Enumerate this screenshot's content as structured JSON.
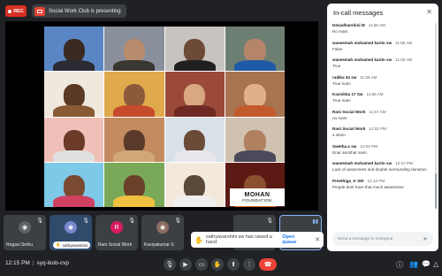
{
  "topbar": {
    "rec_label": "REC",
    "presenting_label": "Social Work Club is presenting"
  },
  "slide": {
    "logo_line1": "MOHAN",
    "logo_line2": "FOUNDATION"
  },
  "participants": [
    {
      "name": "Regavi Sethu",
      "initial": "",
      "color": "#5f6368"
    },
    {
      "name": "sathyavarshini",
      "initial": "",
      "color": "#7986cb"
    },
    {
      "name": "Rani Social Work",
      "initial": "R",
      "color": "#d81b60"
    },
    {
      "name": "Kaviyakumar S",
      "initial": "",
      "color": "#8d6e63"
    },
    {
      "name": "",
      "initial": "",
      "color": "#5f6368"
    },
    {
      "name": "",
      "initial": "",
      "color": "#5f6368"
    }
  ],
  "toast": {
    "text": "sathyavarshini sw has raised a hand",
    "action": "Open queue",
    "close": "✕"
  },
  "bottombar": {
    "time": "12:15 PM",
    "meeting_code": "syq-ikob-cvp"
  },
  "chat": {
    "title": "In-call messages",
    "close": "✕",
    "messages": [
      {
        "sender": "Devadharshini M",
        "time": "11:55 AM",
        "text": "No mam"
      },
      {
        "sender": "waseemah mohamed karim sw",
        "time": "11:56 AM",
        "text": "False"
      },
      {
        "sender": "waseemah mohamed karim sw",
        "time": "11:56 AM",
        "text": "True"
      },
      {
        "sender": "radika 34 sw",
        "time": "11:56 AM",
        "text": "True mam"
      },
      {
        "sender": "Kavishka 17 Sw",
        "time": "11:56 AM",
        "text": "True mam"
      },
      {
        "sender": "Rani Social Work",
        "time": "11:57 AM",
        "text": "no mam"
      },
      {
        "sender": "Rani Social Work",
        "time": "12:01 PM",
        "text": "a stiam"
      },
      {
        "sender": "Swetha.s sw",
        "time": "12:04 PM",
        "text": "Enar amothal mam"
      },
      {
        "sender": "waseemah mohamed karim sw",
        "time": "12:10 PM",
        "text": "Lack of awareness and doubts surrounding donation"
      },
      {
        "sender": "Preethiga_K SW",
        "time": "12:12 PM",
        "text": "People dont have that much awareness"
      }
    ],
    "input_placeholder": "Send a message to everyone"
  },
  "colors": {
    "background": "#202124",
    "end_call": "#ea4335",
    "rec": "#d93025",
    "link": "#1a73e8"
  }
}
